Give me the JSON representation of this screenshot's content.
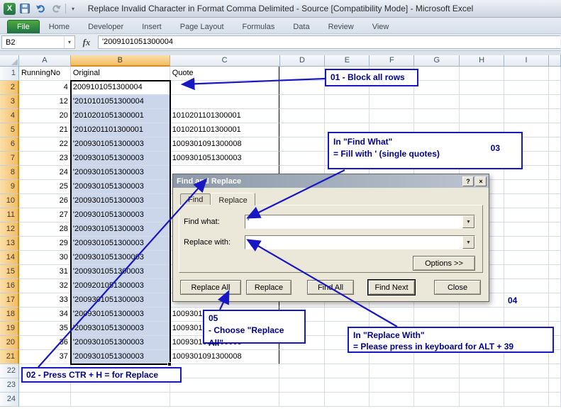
{
  "window": {
    "title": "Replace Invalid Character in Format Comma Delimited - Source  [Compatibility Mode]  -  Microsoft Excel"
  },
  "ribbon": {
    "file_tab": "File",
    "tabs": [
      "Home",
      "Developer",
      "Insert",
      "Page Layout",
      "Formulas",
      "Data",
      "Review",
      "View"
    ]
  },
  "formula_bar": {
    "name_box": "B2",
    "fx": "fx",
    "formula": "'2009101051300004"
  },
  "sheet": {
    "columns": [
      "A",
      "B",
      "C",
      "D",
      "E",
      "F",
      "G",
      "H",
      "I"
    ],
    "selected_range": "B2:B21",
    "rows": [
      {
        "n": "1",
        "A": "RunningNo",
        "B": "Original",
        "C": "Quote"
      },
      {
        "n": "2",
        "A": "4",
        "B": "2009101051300004",
        "C": ""
      },
      {
        "n": "3",
        "A": "12",
        "B": "'2010101051300004",
        "C": ""
      },
      {
        "n": "4",
        "A": "20",
        "B": "'2010201051300001",
        "C": "1010201101300001"
      },
      {
        "n": "5",
        "A": "21",
        "B": "'2010201101300001",
        "C": "1010201101300001"
      },
      {
        "n": "6",
        "A": "22",
        "B": "'2009301051300003",
        "C": "1009301091300008"
      },
      {
        "n": "7",
        "A": "23",
        "B": "'2009301051300003",
        "C": "1009301051300003"
      },
      {
        "n": "8",
        "A": "24",
        "B": "'2009301051300003",
        "C": ""
      },
      {
        "n": "9",
        "A": "25",
        "B": "'2009301051300003",
        "C": ""
      },
      {
        "n": "10",
        "A": "26",
        "B": "'2009301051300003",
        "C": ""
      },
      {
        "n": "11",
        "A": "27",
        "B": "'2009301051300003",
        "C": ""
      },
      {
        "n": "12",
        "A": "28",
        "B": "'2009301051300003",
        "C": ""
      },
      {
        "n": "13",
        "A": "29",
        "B": "'2009301051300003",
        "C": ""
      },
      {
        "n": "14",
        "A": "30",
        "B": "'2009301051300003",
        "C": ""
      },
      {
        "n": "15",
        "A": "31",
        "B": "'2009301051300003",
        "C": ""
      },
      {
        "n": "16",
        "A": "32",
        "B": "'2009201051300003",
        "C": ""
      },
      {
        "n": "17",
        "A": "33",
        "B": "'2009301051300003",
        "C": ""
      },
      {
        "n": "18",
        "A": "34",
        "B": "'2009301051300003",
        "C": "1009301091300008"
      },
      {
        "n": "19",
        "A": "35",
        "B": "'2009301051300003",
        "C": "1009301091300008"
      },
      {
        "n": "20",
        "A": "36",
        "B": "'2009301051300003",
        "C": "1009301091300008"
      },
      {
        "n": "21",
        "A": "37",
        "B": "'2009301051300003",
        "C": "1009301091300008"
      },
      {
        "n": "22",
        "A": "",
        "B": "",
        "C": ""
      },
      {
        "n": "23",
        "A": "",
        "B": "",
        "C": ""
      },
      {
        "n": "24",
        "A": "",
        "B": "",
        "C": ""
      }
    ]
  },
  "dialog": {
    "title": "Find and Replace",
    "help_glyph": "?",
    "close_glyph": "×",
    "tabs": [
      "Find",
      "Replace"
    ],
    "active_tab": "Replace",
    "find_label": "Find what:",
    "find_value": "'",
    "replace_label": "Replace with:",
    "replace_value": "'",
    "options_button": "Options >>",
    "buttons": [
      "Replace All",
      "Replace",
      "Find All",
      "Find Next",
      "Close"
    ]
  },
  "callouts": {
    "c01": "01 - Block all rows",
    "c02": "02 - Press CTR + H = for Replace",
    "c03_line1": "In \"Find What\"",
    "c03_line2": "= Fill with ' (single quotes)",
    "c03_num": "03",
    "c04_line1": "In \"Replace With\"",
    "c04_line2": "= Please press in keyboard for  ALT + 39",
    "c04_num": "04",
    "c05_line1": "05",
    "c05_line2": "- Choose \"Replace All\""
  },
  "colors": {
    "callout_border": "#1717c3",
    "callout_text": "#00008f",
    "selection_fill": "#ccd6ea",
    "header_selected": "#f3bd64",
    "file_tab_green": "#1e7145"
  }
}
